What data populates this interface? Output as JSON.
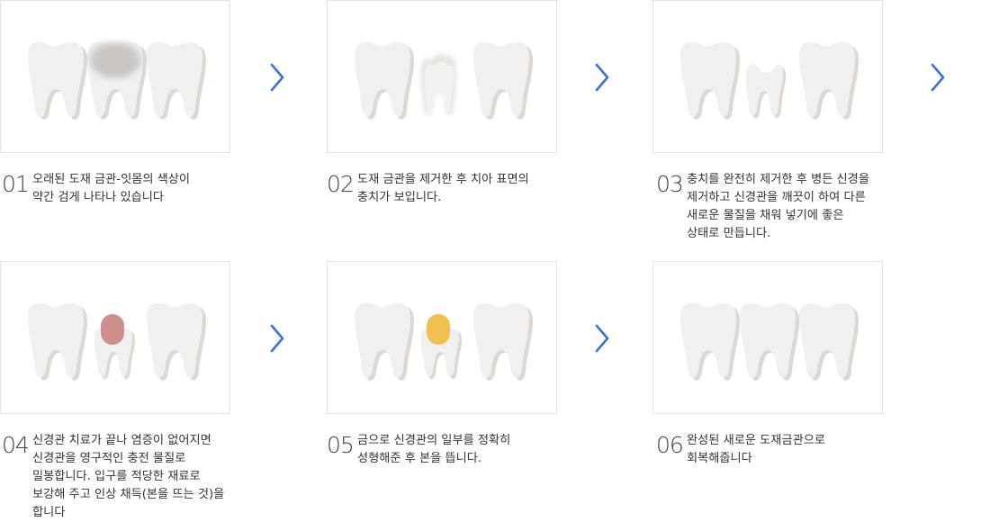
{
  "steps": [
    {
      "num": "01",
      "text": "오래된 도재 금관-잇몸의 색상이\n약간 검게 나타나 있습니다"
    },
    {
      "num": "02",
      "text": "도재 금관을 제거한 후 치아 표면의\n충치가 보입니다."
    },
    {
      "num": "03",
      "text": "충치를 완전히 제거한 후 병든 신경을\n제거하고 신경관을 깨끗이 하여 다른\n새로운 물질을 채워 넣기에 좋은\n상태로 만듭니다."
    },
    {
      "num": "04",
      "text": "신경관 치료가 끝나 염증이 없어지면\n신경관을 영구적인 충전 물질로\n밀봉합니다. 입구를 적당한 재료로\n보강해 주고 인상 채득(본을 뜨는 것)을\n합니다"
    },
    {
      "num": "05",
      "text": "금으로 신경관의 일부를 정확히\n성형해준 후 본을 뜹니다."
    },
    {
      "num": "06",
      "text": "완성된 새로운 도재금관으로\n회복해줍니다"
    }
  ],
  "icons": {
    "arrow": "chevron-right-icon",
    "tooth": "tooth-icon"
  },
  "colors": {
    "tooth": "#f2f0ee",
    "tooth_shadow": "#ddd8d3",
    "arrow": "#3e6fd3",
    "filling_red": "#cf8f8d",
    "filling_gold": "#f0c050",
    "border": "#e3e3e3"
  }
}
